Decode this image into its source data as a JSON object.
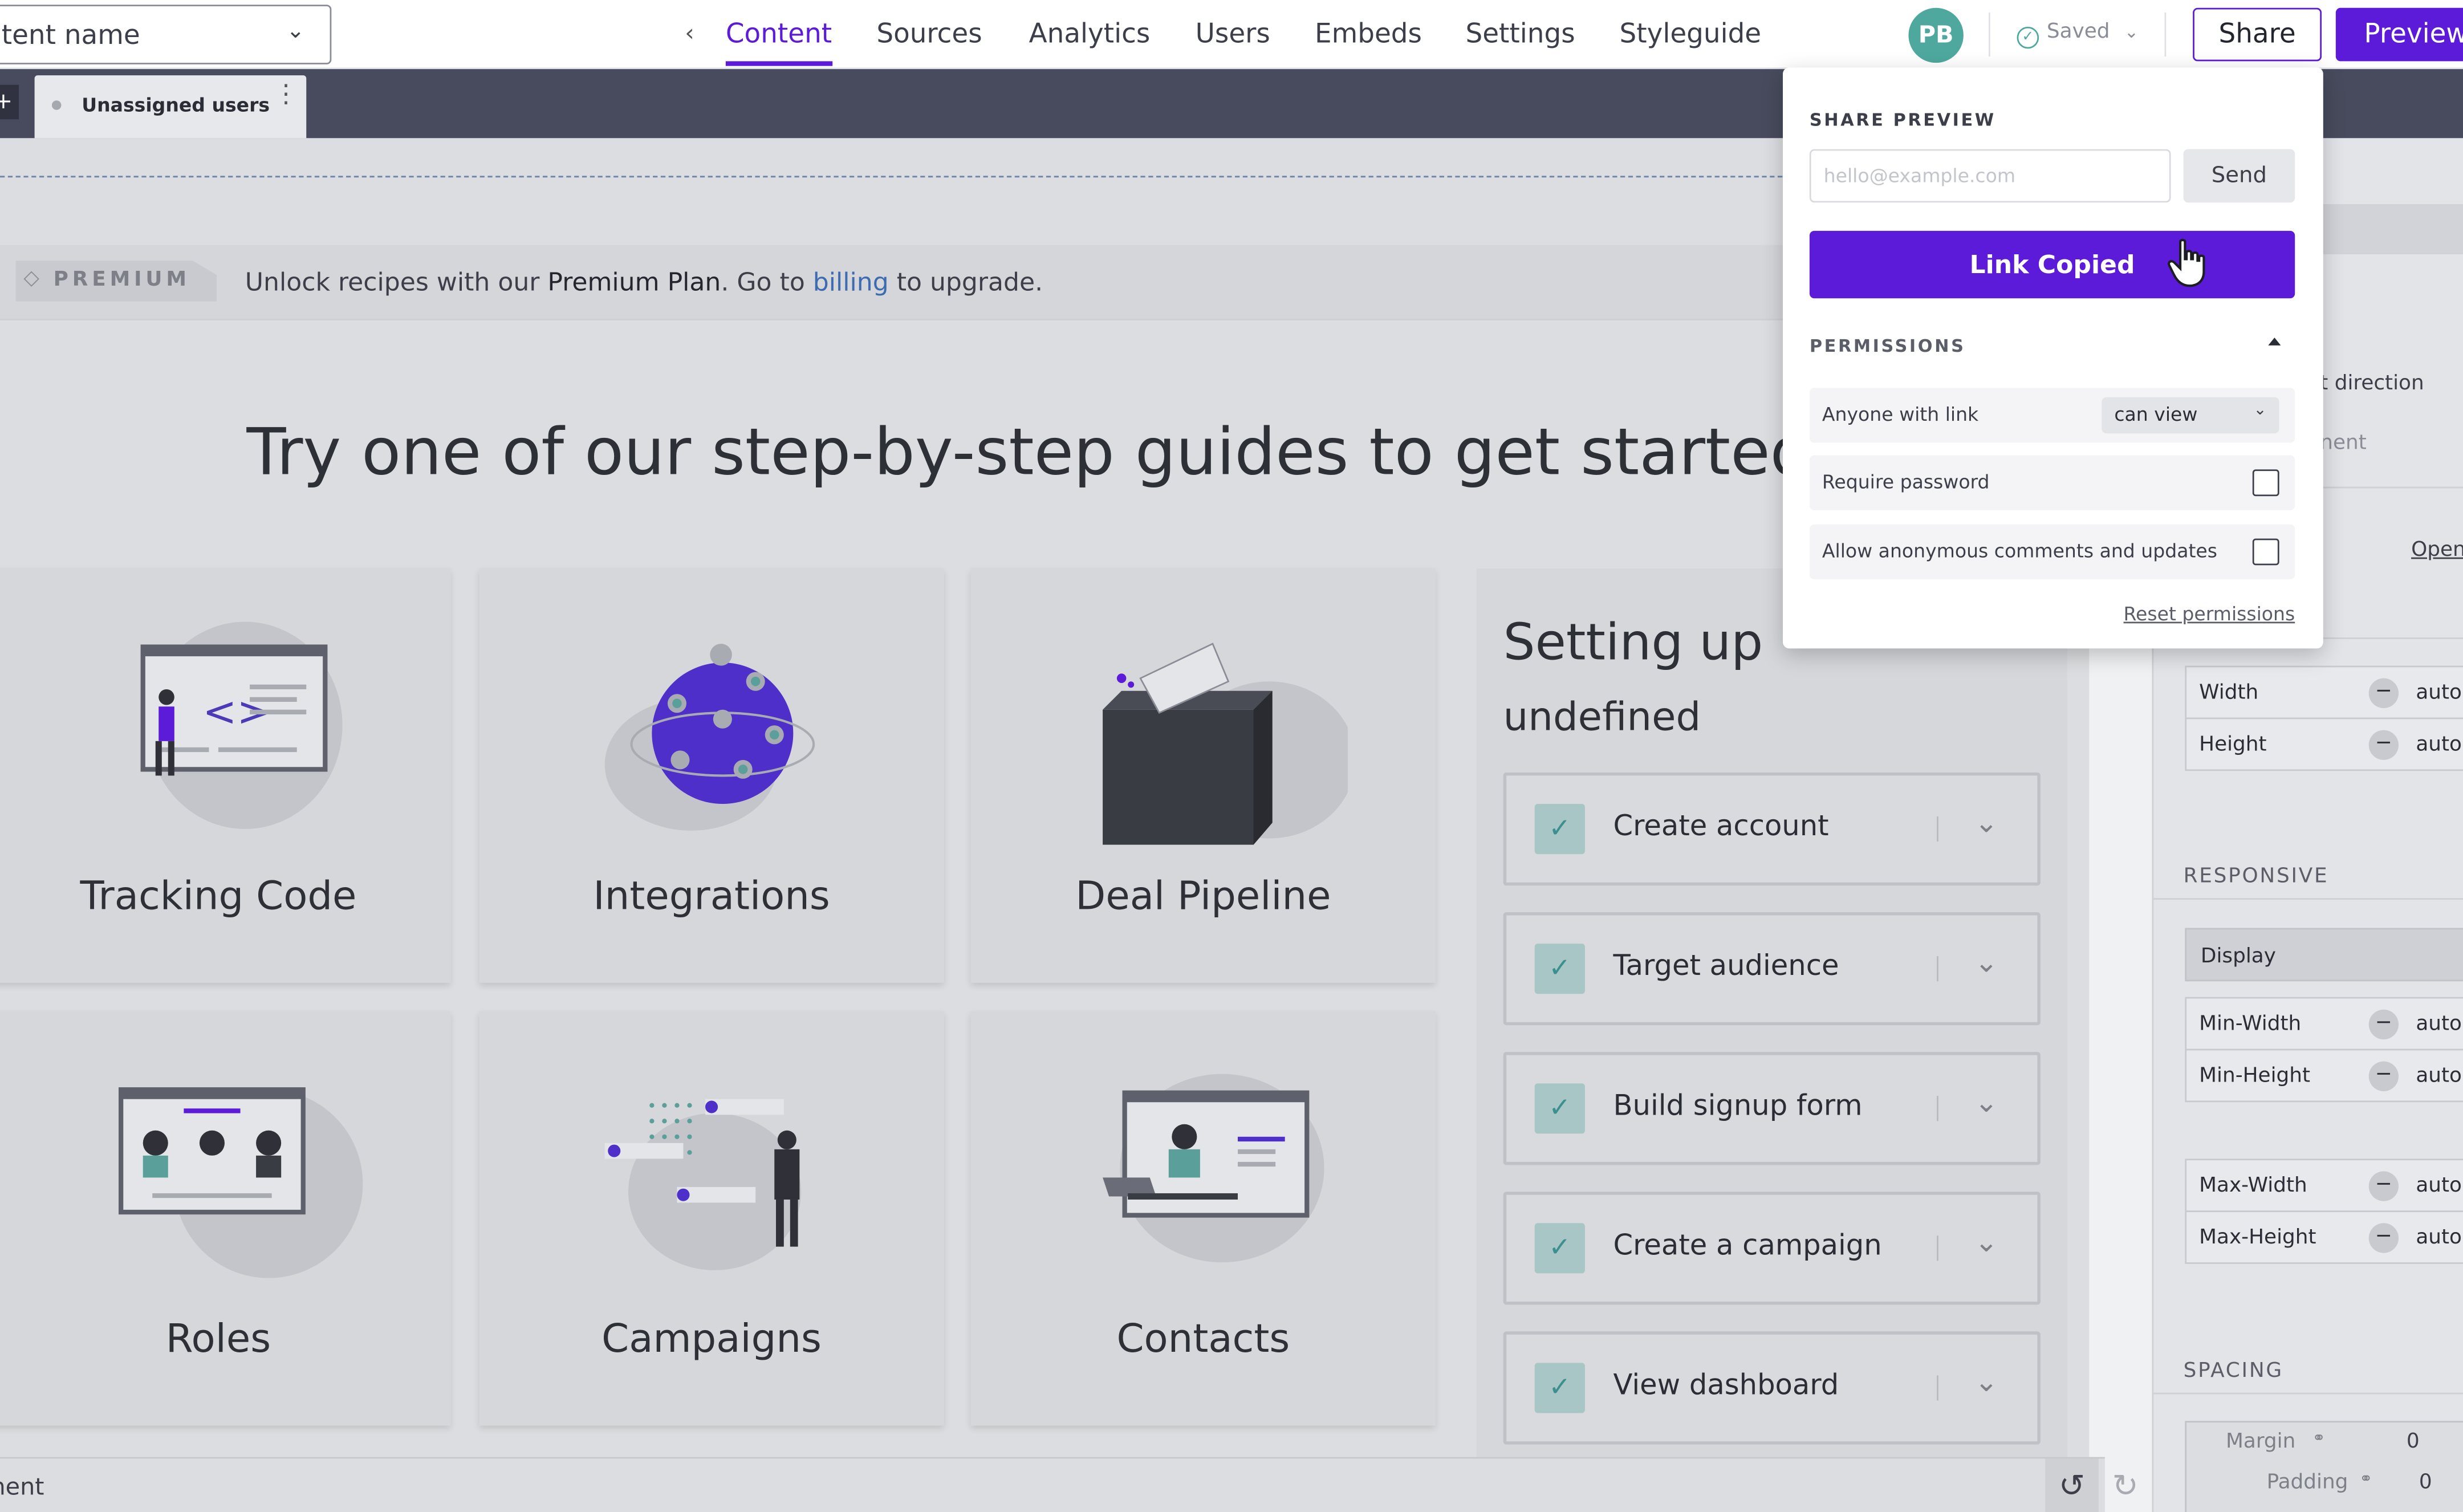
{
  "topnav": {
    "name_select_value": "tent name",
    "tabs": [
      "Content",
      "Sources",
      "Analytics",
      "Users",
      "Embeds",
      "Settings",
      "Styleguide"
    ],
    "active_tab": "Content",
    "avatar_initials": "PB",
    "saved_label": "Saved",
    "share_label": "Share",
    "preview_label": "Preview"
  },
  "tabbar": {
    "add_label": "+",
    "page_tab_label": "Unassigned users"
  },
  "premium": {
    "badge": "PREMIUM",
    "text_before": "Unlock recipes with our ",
    "plan_name": "Premium Plan",
    "text_mid": ". Go to ",
    "link": "billing",
    "text_after": " to upgrade."
  },
  "hero_title": "Try one of our step-by-step guides to get started",
  "cards": [
    {
      "title": "Tracking Code"
    },
    {
      "title": "Integrations"
    },
    {
      "title": "Deal Pipeline"
    },
    {
      "title": "Roles"
    },
    {
      "title": "Campaigns"
    },
    {
      "title": "Contacts"
    }
  ],
  "setup": {
    "title": "Setting up",
    "subtitle": "undefined",
    "steps": [
      "Create account",
      "Target audience",
      "Build signup form",
      "Create a campaign",
      "View dashboard"
    ]
  },
  "statusbar": {
    "text": "nent"
  },
  "properties": {
    "direction_label": "t direction",
    "element_label": "nent",
    "open_link": "Open",
    "size_rows": [
      {
        "label": "Width",
        "value": "auto"
      },
      {
        "label": "Height",
        "value": "auto"
      }
    ],
    "responsive_heading": "RESPONSIVE",
    "display_label": "Display",
    "min_rows": [
      {
        "label": "Min-Width",
        "value": "auto"
      },
      {
        "label": "Min-Height",
        "value": "auto"
      }
    ],
    "max_rows": [
      {
        "label": "Max-Width",
        "value": "auto"
      },
      {
        "label": "Max-Height",
        "value": "auto"
      }
    ],
    "spacing_heading": "SPACING",
    "margin_label": "Margin",
    "margin_value": "0",
    "padding_label": "Padding",
    "padding_value": "0"
  },
  "share_popover": {
    "heading": "SHARE PREVIEW",
    "email_placeholder": "hello@example.com",
    "send_label": "Send",
    "copied_label": "Link Copied",
    "permissions_heading": "PERMISSIONS",
    "anyone_label": "Anyone with link",
    "anyone_value": "can view",
    "password_label": "Require password",
    "anon_label": "Allow anonymous comments and updates",
    "reset_label": "Reset permissions"
  },
  "colors": {
    "accent": "#5b1bd8",
    "avatar": "#4ea89d",
    "tabbar": "#474b5d",
    "link": "#3d6bb0"
  }
}
